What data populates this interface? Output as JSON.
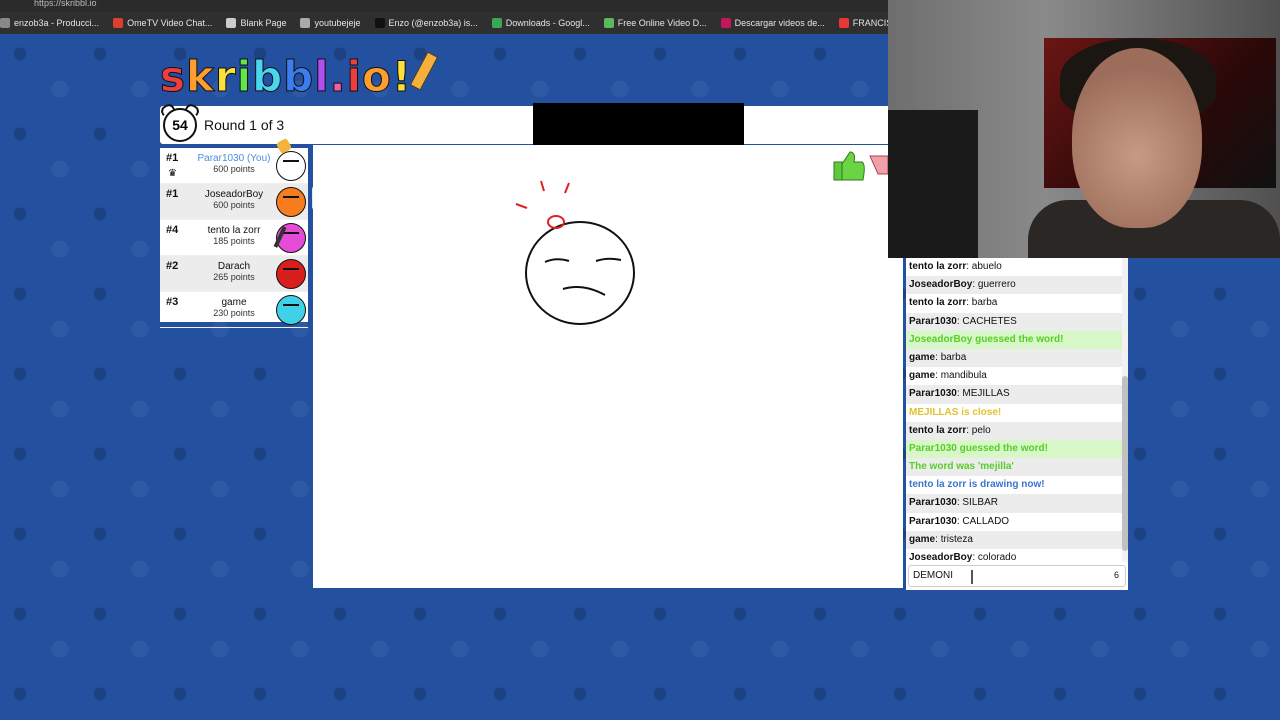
{
  "browser": {
    "url": "https://skribbl.io",
    "bookmarks": [
      {
        "label": "enzob3a - Producci...",
        "color": "#888888"
      },
      {
        "label": "OmeTV Video Chat...",
        "color": "#d9412e"
      },
      {
        "label": "Blank Page",
        "color": "#cccccc"
      },
      {
        "label": "youtubejeje",
        "color": "#aaaaaa"
      },
      {
        "label": "Enzo (@enzob3a) is...",
        "color": "#111111"
      },
      {
        "label": "Downloads - Googl...",
        "color": "#3aa757"
      },
      {
        "label": "Free Online Video D...",
        "color": "#5cb85c"
      },
      {
        "label": "Descargar videos de...",
        "color": "#c2185b"
      },
      {
        "label": "FRANCIS is a Y",
        "color": "#e53935"
      }
    ]
  },
  "logo": {
    "letters": [
      "s",
      "k",
      "r",
      "i",
      "b",
      "b",
      "l",
      ".",
      "i",
      "o",
      "!"
    ],
    "colors": [
      "#ef3e3e",
      "#ff9d2e",
      "#fde13b",
      "#61e64a",
      "#4ad6f0",
      "#3b7df0",
      "#b04ef0",
      "#f05ea5",
      "#ef3e3e",
      "#ff9d2e",
      "#fde13b"
    ]
  },
  "header": {
    "timer": "54",
    "round": "Round 1 of 3"
  },
  "players": [
    {
      "rank": "#1",
      "name": "Parar1030 (You)",
      "points": "600 points",
      "you": true,
      "color": "#ffffff"
    },
    {
      "rank": "#1",
      "name": "JoseadorBoy",
      "points": "600 points",
      "you": false,
      "color": "#f57c1f"
    },
    {
      "rank": "#4",
      "name": "tento la zorr",
      "points": "185 points",
      "you": false,
      "color": "#e44bd6"
    },
    {
      "rank": "#2",
      "name": "Darach",
      "points": "265 points",
      "you": false,
      "color": "#d91e1e"
    },
    {
      "rank": "#3",
      "name": "game",
      "points": "230 points",
      "you": false,
      "color": "#3fd1e8"
    }
  ],
  "tooltip": "colorado",
  "chat": {
    "messages": [
      {
        "user": "tento la zorr",
        "text": "abuelo",
        "type": "normal"
      },
      {
        "user": "JoseadorBoy",
        "text": "guerrero",
        "type": "normal"
      },
      {
        "user": "tento la zorr",
        "text": "barba",
        "type": "normal"
      },
      {
        "user": "Parar1030",
        "text": "CACHETES",
        "type": "normal"
      },
      {
        "user": "",
        "text": "JoseadorBoy guessed the word!",
        "type": "guess"
      },
      {
        "user": "game",
        "text": "barba",
        "type": "normal"
      },
      {
        "user": "game",
        "text": "mandibula",
        "type": "normal"
      },
      {
        "user": "Parar1030",
        "text": "MEJILLAS",
        "type": "normal"
      },
      {
        "user": "",
        "text": "MEJILLAS is close!",
        "type": "close"
      },
      {
        "user": "tento la zorr",
        "text": "pelo",
        "type": "normal"
      },
      {
        "user": "",
        "text": "Parar1030 guessed the word!",
        "type": "guess"
      },
      {
        "user": "",
        "text": "The word was 'mejilla'",
        "type": "word"
      },
      {
        "user": "",
        "text": "tento la zorr is drawing now!",
        "type": "draw"
      },
      {
        "user": "Parar1030",
        "text": "SILBAR",
        "type": "normal"
      },
      {
        "user": "Parar1030",
        "text": "CALLADO",
        "type": "normal"
      },
      {
        "user": "game",
        "text": "tristeza",
        "type": "normal"
      },
      {
        "user": "JoseadorBoy",
        "text": "colorado",
        "type": "normal"
      }
    ],
    "input_value": "DEMONI",
    "char_count": "6"
  }
}
